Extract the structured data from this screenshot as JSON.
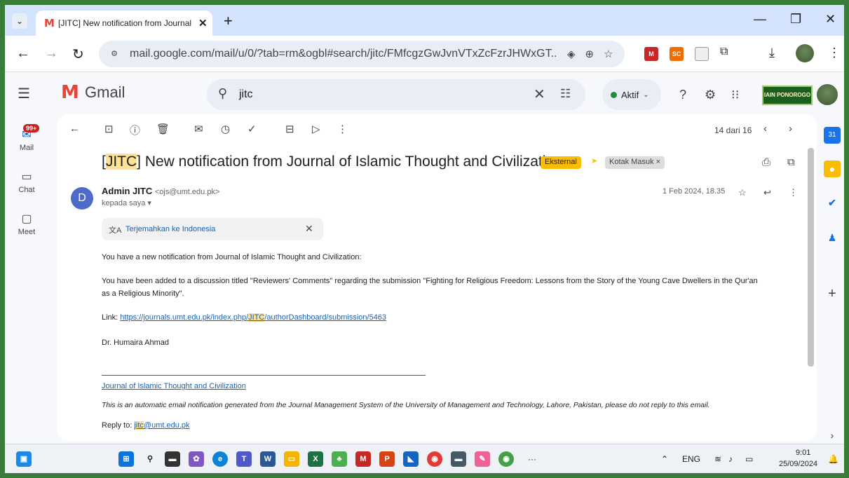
{
  "browser": {
    "tab_title": "[JITC] New notification from Journal of Islamic Thought and Civilization",
    "tab_favicon": "M",
    "new_tab": "+",
    "url": "mail.google.com/mail/u/0/?tab=rm&ogbl#search/jitc/FMfcgzGwJvnVTxZcFzrJHWxGT...",
    "window_controls": {
      "minimize": "—",
      "restore": "❐",
      "close": "✕"
    },
    "extensions": [
      "M",
      "SC"
    ]
  },
  "gmail": {
    "brand": "Gmail",
    "search_value": "jitc",
    "status": "Aktif",
    "org_logo": "IAIN PONOROGO"
  },
  "leftnav": {
    "mail_badge": "99+",
    "mail": "Mail",
    "chat": "Chat",
    "meet": "Meet"
  },
  "toolbar": {
    "count": "14 dari 16"
  },
  "email": {
    "subject_hl": "JITC",
    "subject_rest": "] New notification from Journal of Islamic Thought and Civilization",
    "subject_open": "[",
    "tag_external": "Eksternal",
    "tag_inbox": "Kotak Masuk ×",
    "sender_initial": "D",
    "sender_name": "Admin JITC",
    "sender_email": "<ojs@umt.edu.pk>",
    "to": "kepada saya ▾",
    "date": "1 Feb 2024, 18.35",
    "translate": "Terjemahkan ke Indonesia",
    "p1": "You have a new notification from Journal of Islamic Thought and Civilization:",
    "p2a": "You have been added to a discussion titled \"Reviewers' Comments\" regarding the submission \"Fighting for Religious Freedom: Lessons from the Story of the Young Cave Dwellers in the Qur'an",
    "p2b": "as a Religious Minority\".",
    "link_label": "Link: ",
    "link_pre": "https://journals.umt.edu.pk/index.php/",
    "link_hl": "JITC",
    "link_post": "/authorDashboard/submission/5463",
    "signature": "Dr. Humaira Ahmad",
    "journal_link": "Journal of Islamic Thought and Civilization",
    "auto_notice": "This is an automatic email notification generated from the Journal Management System of the University of Management and Technology, Lahore, Pakistan, please do not reply to this email.",
    "reply_label": "Reply to: ",
    "reply_hl": "jitc",
    "reply_rest": "@umt.edu.pk"
  },
  "taskbar": {
    "lang": "ENG",
    "time": "9:01",
    "date": "25/09/2024",
    "more": "···"
  }
}
